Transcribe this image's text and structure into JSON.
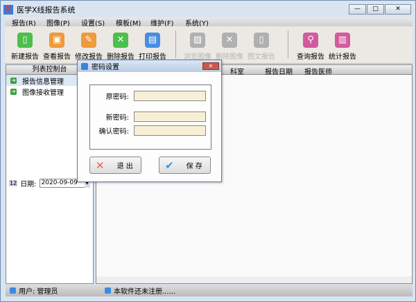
{
  "window": {
    "title": "医学X线报告系统",
    "buttons": [
      "—",
      "□",
      "✕"
    ]
  },
  "menu": [
    "报告(R)",
    "图像(P)",
    "设置(S)",
    "模板(M)",
    "维护(F)",
    "系统(Y)"
  ],
  "toolbar": [
    {
      "label": "新建报告",
      "icon": "new-report-icon",
      "color": "#4cbf4c",
      "glyph": "▯",
      "enabled": true
    },
    {
      "label": "查看报告",
      "icon": "view-report-icon",
      "color": "#ef9a3c",
      "glyph": "▣",
      "enabled": true
    },
    {
      "label": "修改报告",
      "icon": "edit-report-icon",
      "color": "#ef9a3c",
      "glyph": "✎",
      "enabled": true
    },
    {
      "label": "删除报告",
      "icon": "delete-report-icon",
      "color": "#4cbf4c",
      "glyph": "✕",
      "enabled": true
    },
    {
      "label": "打印报告",
      "icon": "print-report-icon",
      "color": "#4a8de0",
      "glyph": "▤",
      "enabled": true
    },
    {
      "label": "浏览图像",
      "icon": "browse-image-icon",
      "color": "#b0b0b0",
      "glyph": "▨",
      "enabled": false
    },
    {
      "label": "删除图像",
      "icon": "delete-image-icon",
      "color": "#b0b0b0",
      "glyph": "✕",
      "enabled": false
    },
    {
      "label": "图文报告",
      "icon": "image-report-icon",
      "color": "#b0b0b0",
      "glyph": "▯",
      "enabled": false
    },
    {
      "label": "查询报告",
      "icon": "search-report-icon",
      "color": "#d25a9e",
      "glyph": "⚲",
      "enabled": true
    },
    {
      "label": "统计报告",
      "icon": "stats-report-icon",
      "color": "#d25a9e",
      "glyph": "▥",
      "enabled": true
    }
  ],
  "left_panel": {
    "header": "列表控制台",
    "items": [
      "报告信息管理",
      "图像接收管理"
    ],
    "date_label": "日期:",
    "date_value": "2020-09-09"
  },
  "table": {
    "columns": [
      "科室",
      "报告日期",
      "报告医师"
    ]
  },
  "status": {
    "user": "用户: 管理员",
    "registration": "本软件还未注册......"
  },
  "dialog": {
    "title": "密码设置",
    "old_label": "原密码:",
    "new_label": "新密码:",
    "confirm_label": "确认密码:",
    "exit_label": "退 出",
    "save_label": "保 存"
  }
}
